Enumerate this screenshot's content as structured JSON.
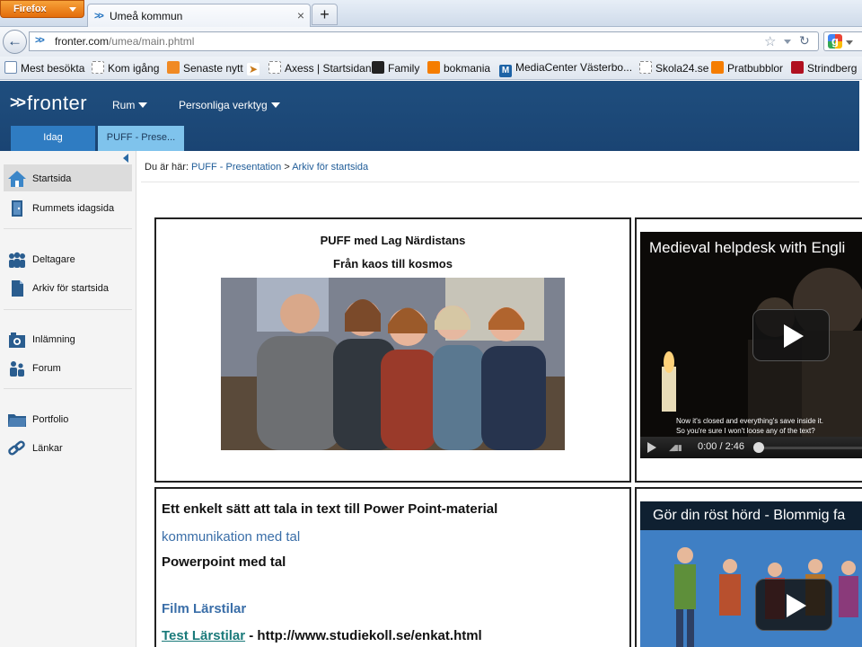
{
  "browser": {
    "menu_button": "Firefox",
    "tab_title": "Umeå kommun",
    "tab_close": "×",
    "new_tab": "+",
    "url_host": "fronter.com",
    "url_path": "/umea/main.phtml",
    "bookmarks": [
      {
        "label": "Mest besökta",
        "icon": "page-icon"
      },
      {
        "label": "Kom igång",
        "icon": "dashed-page-icon"
      },
      {
        "label": "Senaste nytt",
        "icon": "rss-icon"
      },
      {
        "label": "Axess | Startsidan",
        "icon": "dashed-page-icon"
      },
      {
        "label": "Family",
        "icon": "dark-square-icon"
      },
      {
        "label": "bokmania",
        "icon": "blogger-icon"
      },
      {
        "label": "MediaCenter Västerbo...",
        "icon": "m-icon"
      },
      {
        "label": "Skola24.se",
        "icon": "dashed-page-icon"
      },
      {
        "label": "Pratbubblor",
        "icon": "blogger-icon"
      },
      {
        "label": "Strindberg",
        "icon": "red-square-icon"
      }
    ]
  },
  "fronter": {
    "logo": "fronter",
    "menus": [
      {
        "label": "Rum"
      },
      {
        "label": "Personliga verktyg"
      }
    ],
    "tabs": [
      {
        "label": "Idag"
      },
      {
        "label": "PUFF - Prese..."
      }
    ]
  },
  "sidebar": {
    "items": [
      {
        "label": "Startsida",
        "icon": "home-icon"
      },
      {
        "label": "Rummets idagsida",
        "icon": "door-icon"
      },
      {
        "label": "Deltagare",
        "icon": "people-icon"
      },
      {
        "label": "Arkiv för startsida",
        "icon": "document-icon"
      },
      {
        "label": "Inlämning",
        "icon": "inbox-icon"
      },
      {
        "label": "Forum",
        "icon": "forum-icon"
      },
      {
        "label": "Portfolio",
        "icon": "folder-icon"
      },
      {
        "label": "Länkar",
        "icon": "link-icon"
      }
    ]
  },
  "breadcrumb": {
    "prefix": "Du är här:",
    "items": [
      "PUFF - Presentation",
      "Arkiv för startsida"
    ],
    "separator": ">"
  },
  "panels": {
    "intro": {
      "title": "PUFF med Lag Närdistans",
      "subtitle": "Från kaos till kosmos"
    },
    "video1": {
      "title": "Medieval helpdesk with Engli",
      "subtitle_line1": "Now it's closed and everything's save inside it.",
      "subtitle_line2": "So you're sure I won't loose any of the text?",
      "time": "0:00 / 2:46"
    },
    "links": {
      "heading": "Ett enkelt sätt att tala in text till Power Point-material",
      "link1": "kommunikation med tal",
      "heading2": "Powerpoint med tal",
      "link2": "Film Lärstilar",
      "link3": "Test Lärstilar",
      "link3_suffix": " - http://www.studiekoll.se/enkat.html"
    },
    "video2": {
      "title": "Gör din röst hörd - Blommig fa"
    }
  }
}
